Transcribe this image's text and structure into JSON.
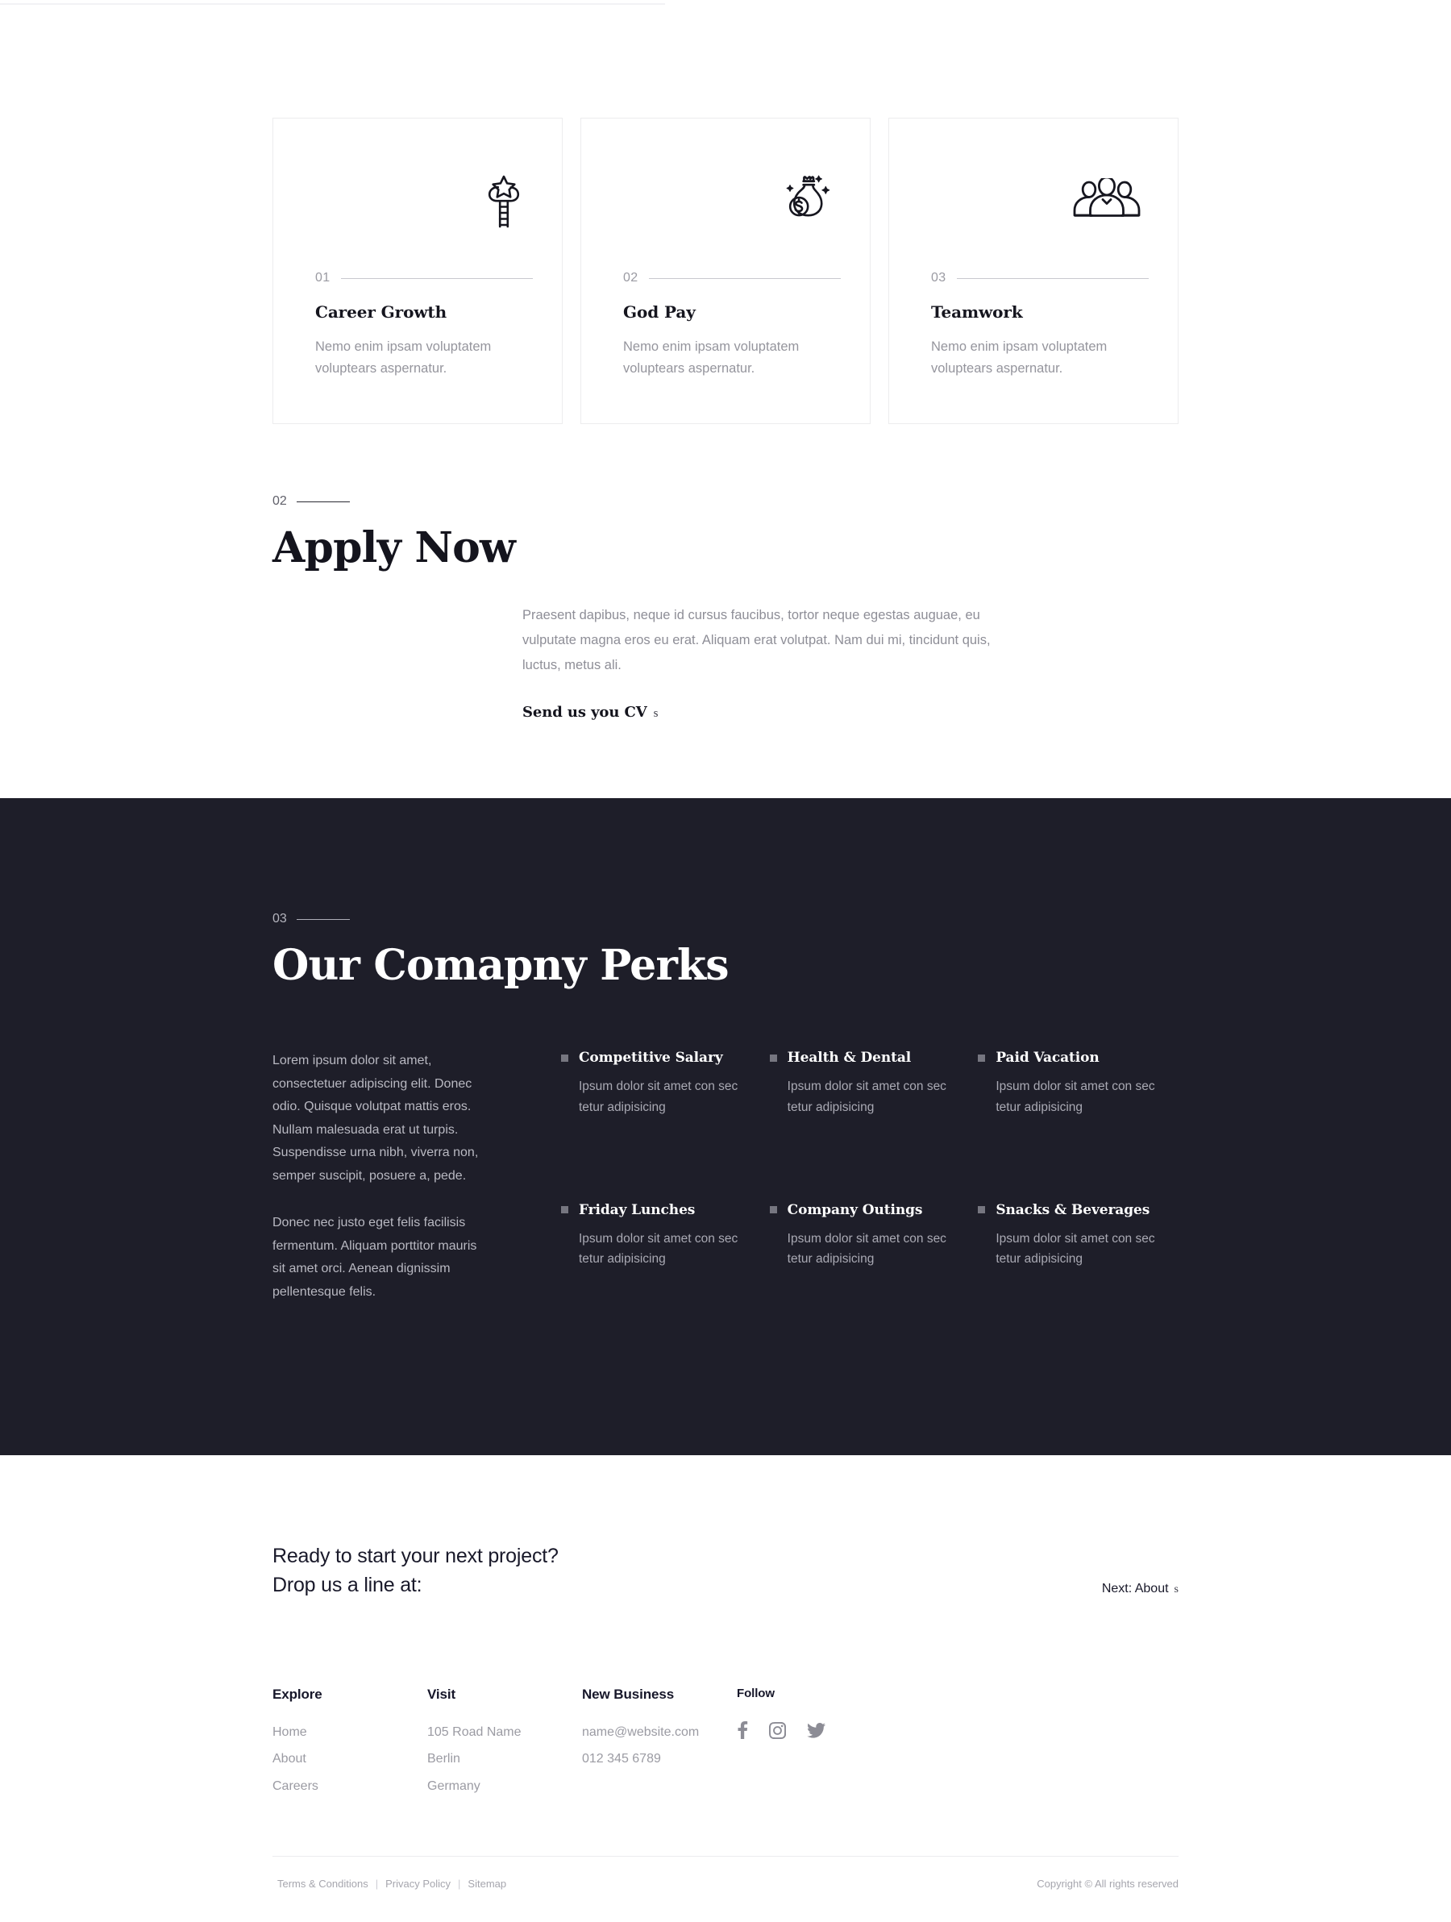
{
  "cards": [
    {
      "number": "01",
      "title": "Career Growth",
      "description": "Nemo enim ipsam voluptatem voluptears aspernatur.",
      "icon": "ladder-to-star-cloud-icon"
    },
    {
      "number": "02",
      "title": "God Pay",
      "description": "Nemo enim ipsam voluptatem voluptears aspernatur.",
      "icon": "money-bag-icon"
    },
    {
      "number": "03",
      "title": "Teamwork",
      "description": "Nemo enim ipsam voluptatem voluptears aspernatur.",
      "icon": "group-of-people-icon"
    }
  ],
  "apply": {
    "number": "02",
    "title": "Apply Now",
    "paragraph": "Praesent dapibus, neque id cursus faucibus, tortor neque egestas auguae, eu vulputate magna eros eu erat. Aliquam erat volutpat. Nam dui mi, tincidunt quis, luctus, metus ali.",
    "cta_label": "Send us you CV",
    "cta_arrow": "s"
  },
  "perks": {
    "number": "03",
    "title": "Our Comapny Perks",
    "intro_paragraphs": [
      "Lorem ipsum dolor sit amet, consectetuer adipiscing elit. Donec odio. Quisque volutpat mattis eros. Nullam malesuada erat ut turpis. Suspendisse urna nibh, viverra non, semper suscipit, posuere a, pede.",
      "Donec nec justo eget felis facilisis fermentum. Aliquam porttitor mauris sit amet orci. Aenean dignissim pellentesque felis."
    ],
    "items": [
      {
        "name": "Competitive Salary",
        "text": "Ipsum dolor sit amet con sec tetur adipisicing"
      },
      {
        "name": "Health & Dental",
        "text": "Ipsum dolor sit amet con sec tetur adipisicing"
      },
      {
        "name": "Paid Vacation",
        "text": "Ipsum dolor sit amet con sec tetur adipisicing"
      },
      {
        "name": "Friday Lunches",
        "text": "Ipsum dolor sit amet con sec tetur adipisicing"
      },
      {
        "name": "Company Outings",
        "text": "Ipsum dolor sit amet con sec tetur adipisicing"
      },
      {
        "name": "Snacks & Beverages",
        "text": "Ipsum dolor sit amet con sec tetur adipisicing"
      }
    ]
  },
  "cta": {
    "line1": "Ready to start your next project?",
    "line2": "Drop us a line at:",
    "next_label": "Next: About",
    "next_arrow": "s"
  },
  "footer": {
    "explore": {
      "heading": "Explore",
      "links": [
        "Home",
        "About",
        "Careers"
      ]
    },
    "visit": {
      "heading": "Visit",
      "lines": [
        "105 Road Name",
        "Berlin",
        "Germany"
      ]
    },
    "new_business": {
      "heading": "New Business",
      "lines": [
        "name@website.com",
        "012 345 6789"
      ]
    },
    "follow": {
      "heading": "Follow",
      "socials": [
        "facebook-icon",
        "instagram-icon",
        "twitter-icon"
      ]
    },
    "legal": {
      "terms": "Terms & Conditions",
      "privacy": "Privacy Policy",
      "sitemap": "Sitemap",
      "separator": "|",
      "copyright": "Copyright © All rights reserved"
    }
  },
  "colors": {
    "dark_section_bg": "#1e1e29",
    "muted_text": "#9b9ba3",
    "card_border": "#ececee"
  }
}
